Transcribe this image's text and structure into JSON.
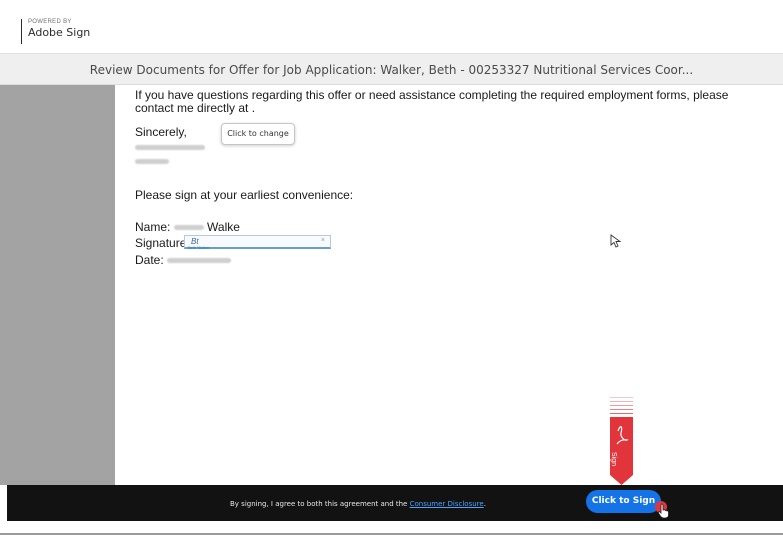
{
  "brand": {
    "powered_by": "POWERED BY",
    "name": "Adobe Sign"
  },
  "title": "Review Documents for Offer for Job Application: Walker, Beth - 00253327 Nutritional Services Coor...",
  "document": {
    "paragraph": "If you have questions regarding this offer or need assistance completing the required employment forms, please contact me directly at .",
    "closing": "Sincerely,",
    "sign_request": "Please sign at your earliest convenience:",
    "name_label": "Name:",
    "name_value_visible": "Walke",
    "signature_label": "Signature:",
    "date_label": "Date:",
    "signature_field": {
      "scribble": "Bt",
      "caption": "Beth Walker",
      "clear_glyph": "×"
    }
  },
  "tooltip": "Click to change",
  "sign_flag_label": "Sign",
  "footer": {
    "agreement_prefix": "By signing, I agree to both this agreement and the",
    "disclosure_link": "Consumer Disclosure",
    "agreement_suffix": ".",
    "sign_button": "Click to Sign"
  },
  "colors": {
    "accent": "#1473e6",
    "flag_red": "#e2353b",
    "footer_bg": "#121212",
    "doc_bg": "#a3a3a3"
  }
}
